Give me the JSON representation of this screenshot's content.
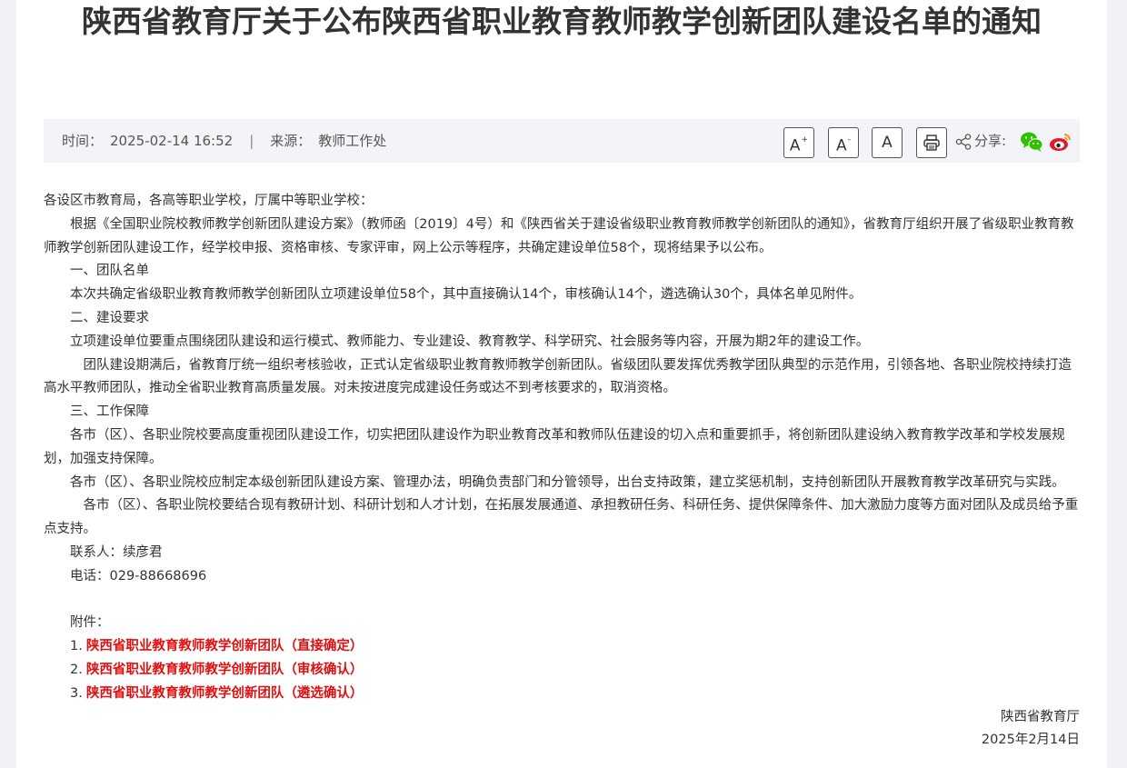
{
  "article": {
    "title": "陕西省教育厅关于公布陕西省职业教育教师教学创新团队建设名单的通知"
  },
  "meta": {
    "time_label": "时间：",
    "time_value": "2025-02-14 16:52",
    "separator": "|",
    "source_label": "来源：",
    "source_value": "教师工作处"
  },
  "toolbar": {
    "font_increase": "A",
    "font_increase_sup": "+",
    "font_decrease": "A",
    "font_decrease_sup": "-",
    "font_reset": "A",
    "share_label": "分享:"
  },
  "icons": {
    "print": "printer-icon",
    "share": "share-icon",
    "wechat": "wechat-icon",
    "weibo": "weibo-icon"
  },
  "colors": {
    "attachment_link": "#e01010",
    "wechat_green": "#2dc100",
    "weibo_red": "#e6162d",
    "meta_bg": "#f3f4f7"
  },
  "body": {
    "salutation": "各设区市教育局，各高等职业学校，厅属中等职业学校：",
    "intro": "根据《全国职业院校教师教学创新团队建设方案》（教师函〔2019〕4号）和《陕西省关于建设省级职业教育教师教学创新团队的通知》，省教育厅组织开展了省级职业教育教师教学创新团队建设工作，经学校申报、资格审核、专家评审，网上公示等程序，共确定建设单位58个，现将结果予以公布。",
    "section1_heading": "一、团队名单",
    "section1_text": "本次共确定省级职业教育教师教学创新团队立项建设单位58个，其中直接确认14个，审核确认14个，遴选确认30个，具体名单见附件。",
    "section2_heading": "二、建设要求",
    "section2_text1": "立项建设单位要重点围绕团队建设和运行模式、教师能力、专业建设、教育教学、科学研究、社会服务等内容，开展为期2年的建设工作。",
    "section2_text2": "团队建设期满后，省教育厅统一组织考核验收，正式认定省级职业教育教师教学创新团队。省级团队要发挥优秀教学团队典型的示范作用，引领各地、各职业院校持续打造高水平教师团队，推动全省职业教育高质量发展。对未按进度完成建设任务或达不到考核要求的，取消资格。",
    "section3_heading": "三、工作保障",
    "section3_text1": "各市（区）、各职业院校要高度重视团队建设工作，切实把团队建设作为职业教育改革和教师队伍建设的切入点和重要抓手，将创新团队建设纳入教育教学改革和学校发展规划，加强支持保障。",
    "section3_text2": "各市（区）、各职业院校应制定本级创新团队建设方案、管理办法，明确负责部门和分管领导，出台支持政策，建立奖惩机制，支持创新团队开展教育教学改革研究与实践。",
    "section3_text3": "各市（区）、各职业院校要结合现有教研计划、科研计划和人才计划，在拓展发展通道、承担教研任务、科研任务、提供保障条件、加大激励力度等方面对团队及成员给予重点支持。",
    "contact": "联系人：续彦君",
    "phone": "电话：029-88668696"
  },
  "attachments": {
    "label": "附件：",
    "items": [
      {
        "num": "1.",
        "title": "陕西省职业教育教师教学创新团队（直接确定）"
      },
      {
        "num": "2.",
        "title": "陕西省职业教育教师教学创新团队（审核确认）"
      },
      {
        "num": "3.",
        "title": "陕西省职业教育教师教学创新团队（遴选确认）"
      }
    ]
  },
  "signature": {
    "org": "陕西省教育厅",
    "date": "2025年2月14日"
  }
}
